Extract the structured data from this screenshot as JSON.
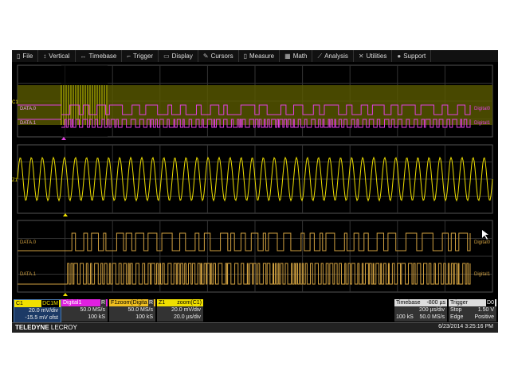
{
  "menu": [
    {
      "label": "File",
      "icon": "file-icon",
      "glyph": "▯"
    },
    {
      "label": "Vertical",
      "icon": "vertical-icon",
      "glyph": "↕"
    },
    {
      "label": "Timebase",
      "icon": "timebase-icon",
      "glyph": "↔"
    },
    {
      "label": "Trigger",
      "icon": "trigger-icon",
      "glyph": "⌐"
    },
    {
      "label": "Display",
      "icon": "display-icon",
      "glyph": "▭"
    },
    {
      "label": "Cursors",
      "icon": "cursors-icon",
      "glyph": "✎"
    },
    {
      "label": "Measure",
      "icon": "measure-icon",
      "glyph": "▯"
    },
    {
      "label": "Math",
      "icon": "math-icon",
      "glyph": "▦"
    },
    {
      "label": "Analysis",
      "icon": "analysis-icon",
      "glyph": "⟋"
    },
    {
      "label": "Utilities",
      "icon": "utilities-icon",
      "glyph": "✕"
    },
    {
      "label": "Support",
      "icon": "support-icon",
      "glyph": "●"
    }
  ],
  "traces": {
    "c1_label": "C1",
    "z1_label": "Z1",
    "data0": "DATA.0",
    "data1": "DATA.1",
    "digital0": "Digital0",
    "digital1": "Digital1"
  },
  "channels": [
    {
      "name": "C1",
      "badge": "DC1M",
      "line1": "20.0 mV/div",
      "line2": "-15.5 mV ofst",
      "color": "#f0e000"
    },
    {
      "name": "Digital1",
      "badge": "R",
      "line1": "50.0 MS/s",
      "line2": "100 kS",
      "color": "#e020e0"
    },
    {
      "name": "F1",
      "title": "zoom(Digita",
      "badge": "R",
      "line1": "50.0 MS/s",
      "line2": "100 kS",
      "color": "#f0c020"
    },
    {
      "name": "Z1",
      "title": "zoom(C1)",
      "line1": "20.0 mV/div",
      "line2": "20.0 µs/div",
      "color": "#f0e000"
    }
  ],
  "timebase": {
    "label": "Timebase",
    "delay": "-800 µs",
    "div": "200 µs/div",
    "samples": "100 kS",
    "rate": "50.0 MS/s"
  },
  "trigger": {
    "label": "Trigger",
    "badge": "D0",
    "mode": "Stop",
    "level": "1.50 V",
    "type": "Edge",
    "slope": "Positive"
  },
  "brand": {
    "bold": "TELEDYNE",
    "light": "LECROY"
  },
  "timestamp": "6/23/2014 3:25:16 PM"
}
